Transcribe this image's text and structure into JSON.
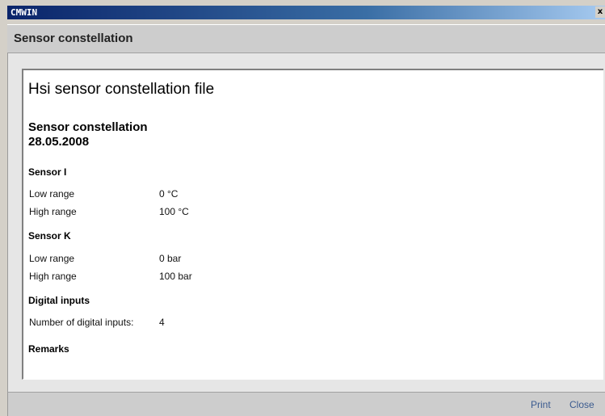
{
  "window": {
    "title": "CMWIN",
    "close_glyph": "x"
  },
  "header": {
    "title": "Sensor constellation"
  },
  "document": {
    "title": "Hsi sensor constellation file",
    "subtitle": "Sensor constellation",
    "date": "28.05.2008",
    "sections": {
      "sensor_i": {
        "heading": "Sensor I",
        "rows": [
          {
            "label": "Low range",
            "value": "0 °C"
          },
          {
            "label": "High range",
            "value": "100 °C"
          }
        ]
      },
      "sensor_k": {
        "heading": "Sensor K",
        "rows": [
          {
            "label": "Low range",
            "value": "0 bar"
          },
          {
            "label": "High range",
            "value": "100 bar"
          }
        ]
      },
      "digital_inputs": {
        "heading": "Digital inputs",
        "rows": [
          {
            "label": "Number of digital inputs:",
            "value": "4"
          }
        ]
      },
      "remarks": {
        "heading": "Remarks"
      }
    }
  },
  "footer": {
    "print_label": "Print",
    "close_label": "Close"
  },
  "colors": {
    "titlebar_start": "#0a246a",
    "header_band": "#cdcdcd",
    "link": "#3b5b8f"
  }
}
